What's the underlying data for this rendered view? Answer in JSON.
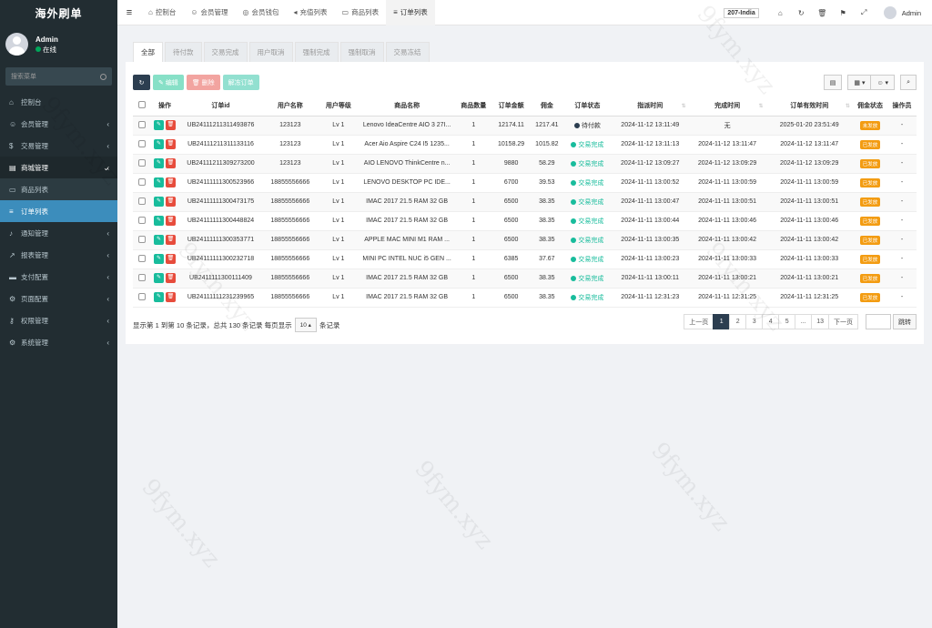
{
  "brand": "海外刷单",
  "user": {
    "name": "Admin",
    "status": "在线"
  },
  "search_placeholder": "搜索菜单",
  "menu": [
    {
      "icon": "dashboard-icon",
      "glyph": "⌂",
      "label": "控制台",
      "chevron": false,
      "state": ""
    },
    {
      "icon": "user-icon",
      "glyph": "☺",
      "label": "会员管理",
      "chevron": true,
      "state": ""
    },
    {
      "icon": "dollar-icon",
      "glyph": "$",
      "label": "交易管理",
      "chevron": true,
      "state": ""
    },
    {
      "icon": "shop-icon",
      "glyph": "▤",
      "label": "商城管理",
      "chevron": true,
      "state": "open"
    },
    {
      "icon": "monitor-icon",
      "glyph": "▭",
      "label": "商品列表",
      "chevron": false,
      "state": "sub"
    },
    {
      "icon": "list-icon",
      "glyph": "≡",
      "label": "订单列表",
      "chevron": false,
      "state": "active"
    },
    {
      "icon": "bell-icon",
      "glyph": "♪",
      "label": "通知管理",
      "chevron": true,
      "state": ""
    },
    {
      "icon": "chart-icon",
      "glyph": "↗",
      "label": "报表管理",
      "chevron": true,
      "state": ""
    },
    {
      "icon": "card-icon",
      "glyph": "▬",
      "label": "支付配置",
      "chevron": true,
      "state": ""
    },
    {
      "icon": "settings-icon",
      "glyph": "⚙",
      "label": "页面配置",
      "chevron": true,
      "state": ""
    },
    {
      "icon": "key-icon",
      "glyph": "⚷",
      "label": "权限管理",
      "chevron": true,
      "state": ""
    },
    {
      "icon": "gears-icon",
      "glyph": "⚙",
      "label": "系统管理",
      "chevron": true,
      "state": ""
    }
  ],
  "top_tabs": [
    {
      "icon": "dashboard-icon",
      "glyph": "⌂",
      "label": "控制台",
      "active": false
    },
    {
      "icon": "user-icon",
      "glyph": "☺",
      "label": "会员管理",
      "active": false
    },
    {
      "icon": "globe-icon",
      "glyph": "◎",
      "label": "会员钱包",
      "active": false
    },
    {
      "icon": "megaphone-icon",
      "glyph": "◂",
      "label": "充值列表",
      "active": false
    },
    {
      "icon": "monitor-icon",
      "glyph": "▭",
      "label": "商品列表",
      "active": false
    },
    {
      "icon": "list-icon",
      "glyph": "≡",
      "label": "订单列表",
      "active": true
    }
  ],
  "top_right": {
    "domain": "207-India",
    "admin": "Admin"
  },
  "status_tabs": [
    "全部",
    "待付款",
    "交易完成",
    "用户取消",
    "强制完成",
    "强制取消",
    "交易冻结"
  ],
  "toolbar": {
    "edit": "编辑",
    "delete": "删除",
    "unfreeze": "解冻订单"
  },
  "columns": [
    "操作",
    "订单id",
    "用户名称",
    "用户等级",
    "商品名称",
    "商品数量",
    "订单金额",
    "佣金",
    "订单状态",
    "指派时间",
    "完成时间",
    "订单有效时间",
    "佣金状态",
    "操作员"
  ],
  "rows": [
    {
      "id": "UB24111211311493876",
      "user": "123123",
      "level": "Lv 1",
      "product": "Lenovo IdeaCentre AIO 3 27I...",
      "qty": "1",
      "amount": "12174.11",
      "commission": "1217.41",
      "status": "待付款",
      "status_color": "#2c3e50",
      "assigned": "2024-11-12 13:11:49",
      "completed": "无",
      "valid": "2025-01-20 23:51:49",
      "comm_status": "未发放",
      "operator": "-"
    },
    {
      "id": "UB24111211311133116",
      "user": "123123",
      "level": "Lv 1",
      "product": "Acer Aio Aspire C24 I5 1235...",
      "qty": "1",
      "amount": "10158.29",
      "commission": "1015.82",
      "status": "交易完成",
      "status_color": "#18bc9c",
      "assigned": "2024-11-12 13:11:13",
      "completed": "2024-11-12 13:11:47",
      "valid": "2024-11-12 13:11:47",
      "comm_status": "已发放",
      "operator": "-"
    },
    {
      "id": "UB24111211309273200",
      "user": "123123",
      "level": "Lv 1",
      "product": "AIO LENOVO ThinkCentre n...",
      "qty": "1",
      "amount": "9880",
      "commission": "58.29",
      "status": "交易完成",
      "status_color": "#18bc9c",
      "assigned": "2024-11-12 13:09:27",
      "completed": "2024-11-12 13:09:29",
      "valid": "2024-11-12 13:09:29",
      "comm_status": "已发放",
      "operator": "-"
    },
    {
      "id": "UB24111111300523966",
      "user": "18855556666",
      "level": "Lv 1",
      "product": "LENOVO DESKTOP PC IDE...",
      "qty": "1",
      "amount": "6700",
      "commission": "39.53",
      "status": "交易完成",
      "status_color": "#18bc9c",
      "assigned": "2024-11-11 13:00:52",
      "completed": "2024-11-11 13:00:59",
      "valid": "2024-11-11 13:00:59",
      "comm_status": "已发放",
      "operator": "-"
    },
    {
      "id": "UB24111111300473175",
      "user": "18855556666",
      "level": "Lv 1",
      "product": "IMAC 2017 21.5 RAM 32 GB",
      "qty": "1",
      "amount": "6500",
      "commission": "38.35",
      "status": "交易完成",
      "status_color": "#18bc9c",
      "assigned": "2024-11-11 13:00:47",
      "completed": "2024-11-11 13:00:51",
      "valid": "2024-11-11 13:00:51",
      "comm_status": "已发放",
      "operator": "-"
    },
    {
      "id": "UB24111111300448824",
      "user": "18855556666",
      "level": "Lv 1",
      "product": "IMAC 2017 21.5 RAM 32 GB",
      "qty": "1",
      "amount": "6500",
      "commission": "38.35",
      "status": "交易完成",
      "status_color": "#18bc9c",
      "assigned": "2024-11-11 13:00:44",
      "completed": "2024-11-11 13:00:46",
      "valid": "2024-11-11 13:00:46",
      "comm_status": "已发放",
      "operator": "-"
    },
    {
      "id": "UB24111111300353771",
      "user": "18855556666",
      "level": "Lv 1",
      "product": "APPLE MAC MINI M1 RAM ...",
      "qty": "1",
      "amount": "6500",
      "commission": "38.35",
      "status": "交易完成",
      "status_color": "#18bc9c",
      "assigned": "2024-11-11 13:00:35",
      "completed": "2024-11-11 13:00:42",
      "valid": "2024-11-11 13:00:42",
      "comm_status": "已发放",
      "operator": "-"
    },
    {
      "id": "UB24111111300232718",
      "user": "18855556666",
      "level": "Lv 1",
      "product": "MINI PC INTEL NUC i5 GEN ...",
      "qty": "1",
      "amount": "6385",
      "commission": "37.67",
      "status": "交易完成",
      "status_color": "#18bc9c",
      "assigned": "2024-11-11 13:00:23",
      "completed": "2024-11-11 13:00:33",
      "valid": "2024-11-11 13:00:33",
      "comm_status": "已发放",
      "operator": "-"
    },
    {
      "id": "UB2411111300111409",
      "user": "18855556666",
      "level": "Lv 1",
      "product": "IMAC 2017 21.5 RAM 32 GB",
      "qty": "1",
      "amount": "6500",
      "commission": "38.35",
      "status": "交易完成",
      "status_color": "#18bc9c",
      "assigned": "2024-11-11 13:00:11",
      "completed": "2024-11-11 13:00:21",
      "valid": "2024-11-11 13:00:21",
      "comm_status": "已发放",
      "operator": "-"
    },
    {
      "id": "UB24111111231239965",
      "user": "18855556666",
      "level": "Lv 1",
      "product": "IMAC 2017 21.5 RAM 32 GB",
      "qty": "1",
      "amount": "6500",
      "commission": "38.35",
      "status": "交易完成",
      "status_color": "#18bc9c",
      "assigned": "2024-11-11 12:31:23",
      "completed": "2024-11-11 12:31:25",
      "valid": "2024-11-11 12:31:25",
      "comm_status": "已发放",
      "operator": "-"
    }
  ],
  "footer": {
    "showing": "显示第 1 到第 10 条记录，总共 130 条记录 每页显示",
    "per_page": "10",
    "suffix": "条记录"
  },
  "pagination": {
    "prev": "上一页",
    "pages": [
      "1",
      "2",
      "3",
      "4",
      "5",
      "...",
      "13"
    ],
    "next": "下一页",
    "go": "跳转"
  },
  "watermark": "9fym.xyz",
  "colors": {
    "sidebar": "#222d32",
    "active": "#3c8dbc",
    "success": "#18bc9c",
    "danger": "#e74c3c",
    "warning": "#f39c12"
  }
}
